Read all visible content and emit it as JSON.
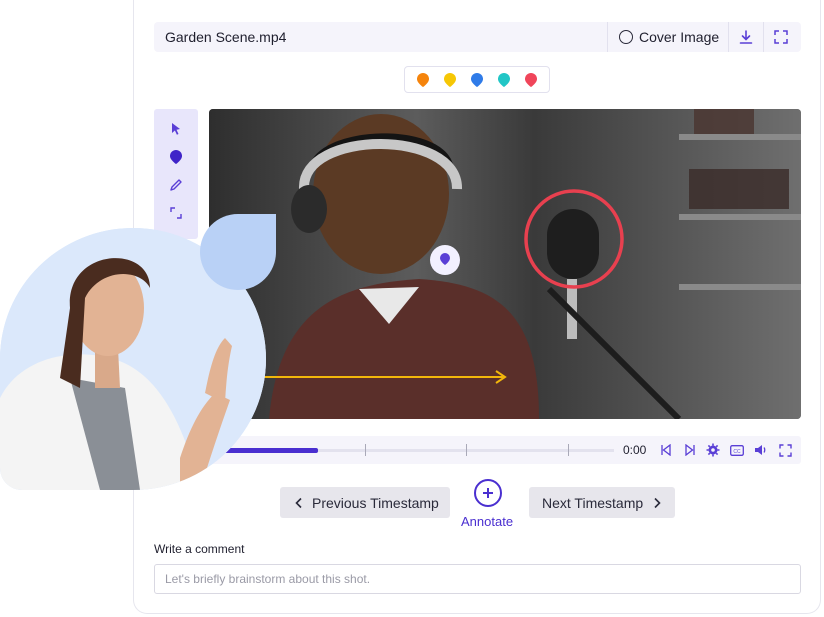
{
  "file": {
    "name": "Garden Scene.mp4"
  },
  "toolbar": {
    "cover_label": "Cover Image",
    "download_icon": "download-icon",
    "fullscreen_icon": "fullscreen-icon"
  },
  "palette": {
    "colors": [
      "#f5840c",
      "#f6c705",
      "#2f7be8",
      "#22c6c6",
      "#f0455a"
    ]
  },
  "tools": [
    "pointer-icon",
    "pin-icon",
    "pencil-icon",
    "expand-icon"
  ],
  "player": {
    "time": "0:00",
    "progress": 0.27,
    "controls": [
      "skip-back-icon",
      "skip-forward-icon",
      "settings-icon",
      "captions-icon",
      "volume-icon",
      "fullscreen-icon"
    ]
  },
  "annotation": {
    "circle_color": "#e8404f",
    "arrow_color": "#f2b70b",
    "marker_color": "#5a3fd6"
  },
  "nav": {
    "prev_label": "Previous Timestamp",
    "next_label": "Next Timestamp",
    "annotate_label": "Annotate"
  },
  "comment": {
    "label": "Write a comment",
    "placeholder": "Let's briefly brainstorm about this shot."
  }
}
